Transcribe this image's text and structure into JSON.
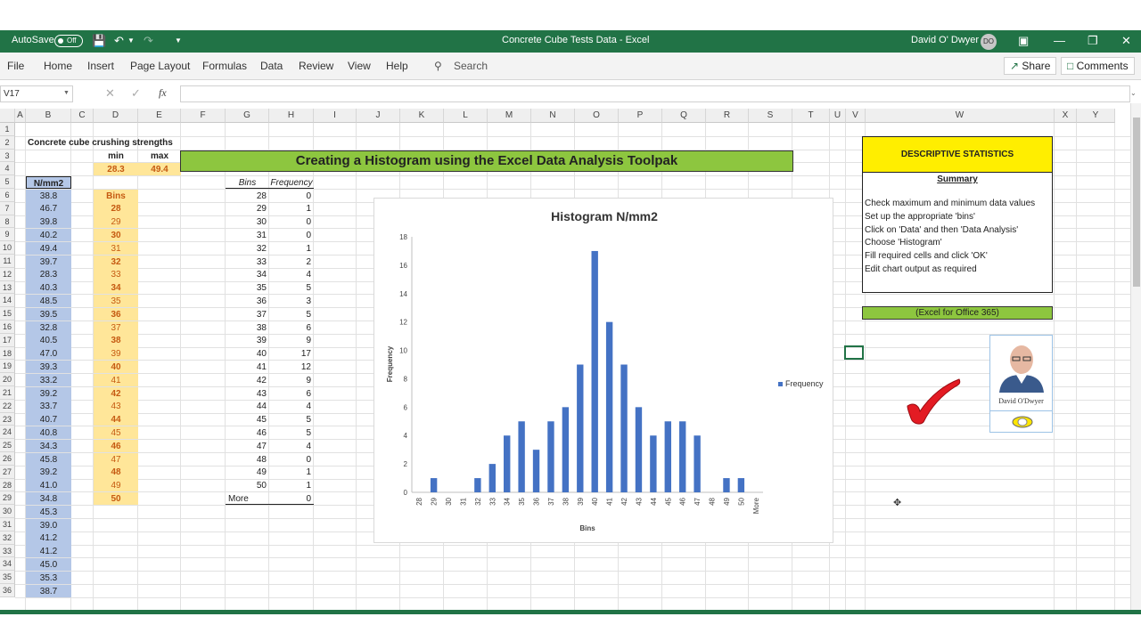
{
  "titlebar": {
    "autosave_label": "AutoSave",
    "autosave_state": "Off",
    "doc_title": "Concrete Cube Tests Data  -  Excel",
    "user_name": "David O' Dwyer",
    "user_initials": "DO"
  },
  "ribbon": {
    "tabs": [
      "File",
      "Home",
      "Insert",
      "Page Layout",
      "Formulas",
      "Data",
      "Review",
      "View",
      "Help"
    ],
    "search": "Search",
    "share": "Share",
    "comments": "Comments"
  },
  "formula_bar": {
    "name_box": "V17",
    "fx": "fx",
    "value": ""
  },
  "columns": [
    "A",
    "B",
    "C",
    "D",
    "E",
    "F",
    "G",
    "H",
    "I",
    "J",
    "K",
    "L",
    "M",
    "N",
    "O",
    "P",
    "Q",
    "R",
    "S",
    "T",
    "U",
    "V",
    "W",
    "X",
    "Y"
  ],
  "rows": [
    "1",
    "2",
    "3",
    "4",
    "5",
    "6",
    "7",
    "8",
    "9",
    "10",
    "11",
    "12",
    "13",
    "14",
    "15",
    "16",
    "17",
    "18",
    "19",
    "20",
    "21",
    "22",
    "23",
    "24",
    "25",
    "26",
    "27",
    "28",
    "29",
    "30",
    "31",
    "32",
    "33",
    "34",
    "35",
    "36"
  ],
  "sheet": {
    "b2_title": "Concrete cube crushing strengths",
    "min_label": "min",
    "max_label": "max",
    "min_value": "28.3",
    "max_value": "49.4",
    "b5_header": "N/mm2",
    "strengths": [
      "38.8",
      "46.7",
      "39.8",
      "40.2",
      "49.4",
      "39.7",
      "28.3",
      "40.3",
      "48.5",
      "39.5",
      "32.8",
      "40.5",
      "47.0",
      "39.3",
      "33.2",
      "39.2",
      "33.7",
      "40.7",
      "40.8",
      "34.3",
      "45.8",
      "39.2",
      "41.0",
      "34.8",
      "45.3",
      "39.0",
      "41.2",
      "41.2",
      "45.0",
      "35.3",
      "38.7"
    ],
    "bins_label": "Bins",
    "bins": [
      "28",
      "29",
      "30",
      "31",
      "32",
      "33",
      "34",
      "35",
      "36",
      "37",
      "38",
      "39",
      "40",
      "41",
      "42",
      "43",
      "44",
      "45",
      "46",
      "47",
      "48",
      "49",
      "50"
    ],
    "banner": "Creating a Histogram using the Excel Data Analysis Toolpak",
    "freq_table": {
      "header_bins": "Bins",
      "header_freq": "Frequency",
      "bins": [
        "28",
        "29",
        "30",
        "31",
        "32",
        "33",
        "34",
        "35",
        "36",
        "37",
        "38",
        "39",
        "40",
        "41",
        "42",
        "43",
        "44",
        "45",
        "46",
        "47",
        "48",
        "49",
        "50",
        "More"
      ],
      "freqs": [
        "0",
        "1",
        "0",
        "0",
        "1",
        "2",
        "4",
        "5",
        "3",
        "5",
        "6",
        "9",
        "17",
        "12",
        "9",
        "6",
        "4",
        "5",
        "5",
        "4",
        "0",
        "1",
        "1",
        "0"
      ]
    }
  },
  "descriptive": {
    "title": "DESCRIPTIVE STATISTICS",
    "summary": "Summary",
    "steps": [
      "Check maximum and minimum data values",
      "Set up the appropriate 'bins'",
      "Click on 'Data' and then 'Data Analysis'",
      "Choose 'Histogram'",
      "Fill required cells and click 'OK'",
      "Edit chart output as required"
    ],
    "office_label": "(Excel for Office 365)"
  },
  "photo_card": {
    "name": "David O'Dwyer"
  },
  "chart_data": {
    "type": "bar",
    "title": "Histogram  N/mm2",
    "xlabel": "Bins",
    "ylabel": "Frequency",
    "categories": [
      "28",
      "29",
      "30",
      "31",
      "32",
      "33",
      "34",
      "35",
      "36",
      "37",
      "38",
      "39",
      "40",
      "41",
      "42",
      "43",
      "44",
      "45",
      "46",
      "47",
      "48",
      "49",
      "50",
      "More"
    ],
    "series": [
      {
        "name": "Frequency",
        "values": [
          0,
          1,
          0,
          0,
          1,
          2,
          4,
          5,
          3,
          5,
          6,
          9,
          17,
          12,
          9,
          6,
          4,
          5,
          5,
          4,
          0,
          1,
          1,
          0
        ]
      }
    ],
    "ylim": [
      0,
      18
    ],
    "yticks": [
      0,
      2,
      4,
      6,
      8,
      10,
      12,
      14,
      16,
      18
    ],
    "legend": "right",
    "grid": false,
    "bar_color": "#4472c4"
  }
}
